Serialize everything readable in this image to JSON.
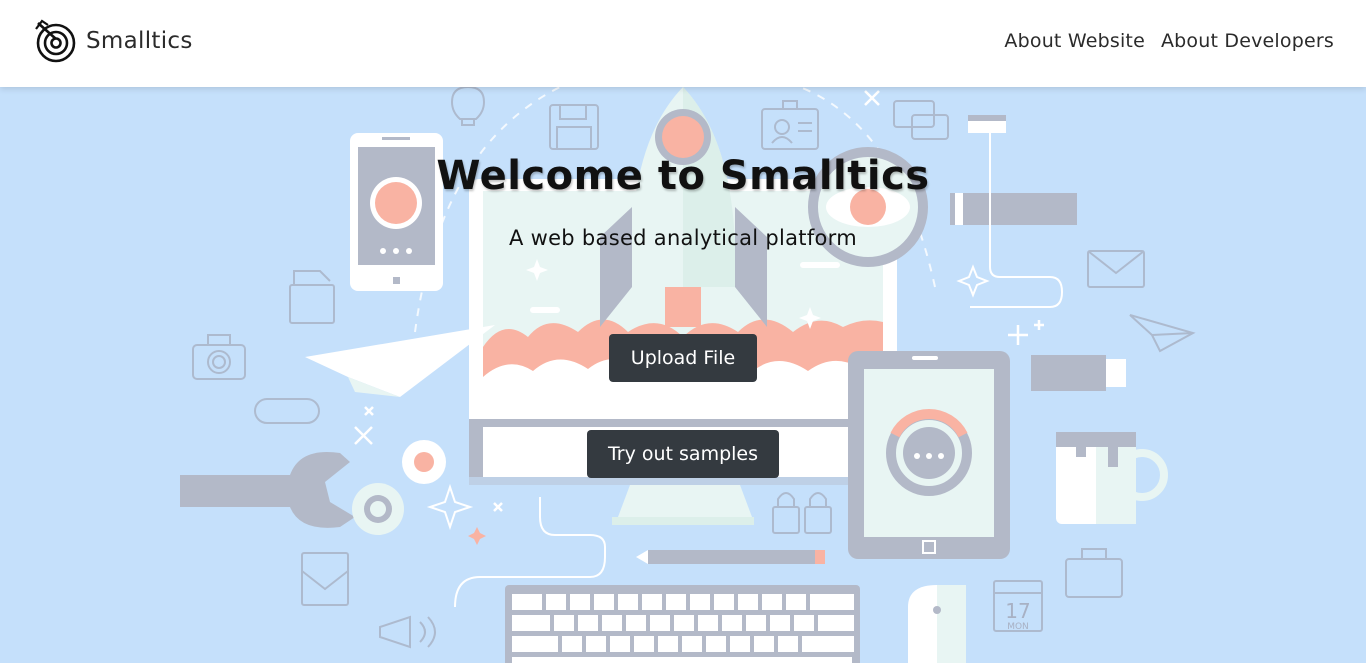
{
  "navbar": {
    "brand_name": "Smalltics",
    "brand_icon": "spiral-logo-icon",
    "links": [
      {
        "label": "About Website"
      },
      {
        "label": "About Developers"
      }
    ]
  },
  "hero": {
    "title": "Welcome to Smalltics",
    "subtitle": "A web based analytical platform",
    "upload_label": "Upload File",
    "samples_label": "Try out samples",
    "background_color": "#c5e0fb",
    "button_color": "#343a40"
  }
}
